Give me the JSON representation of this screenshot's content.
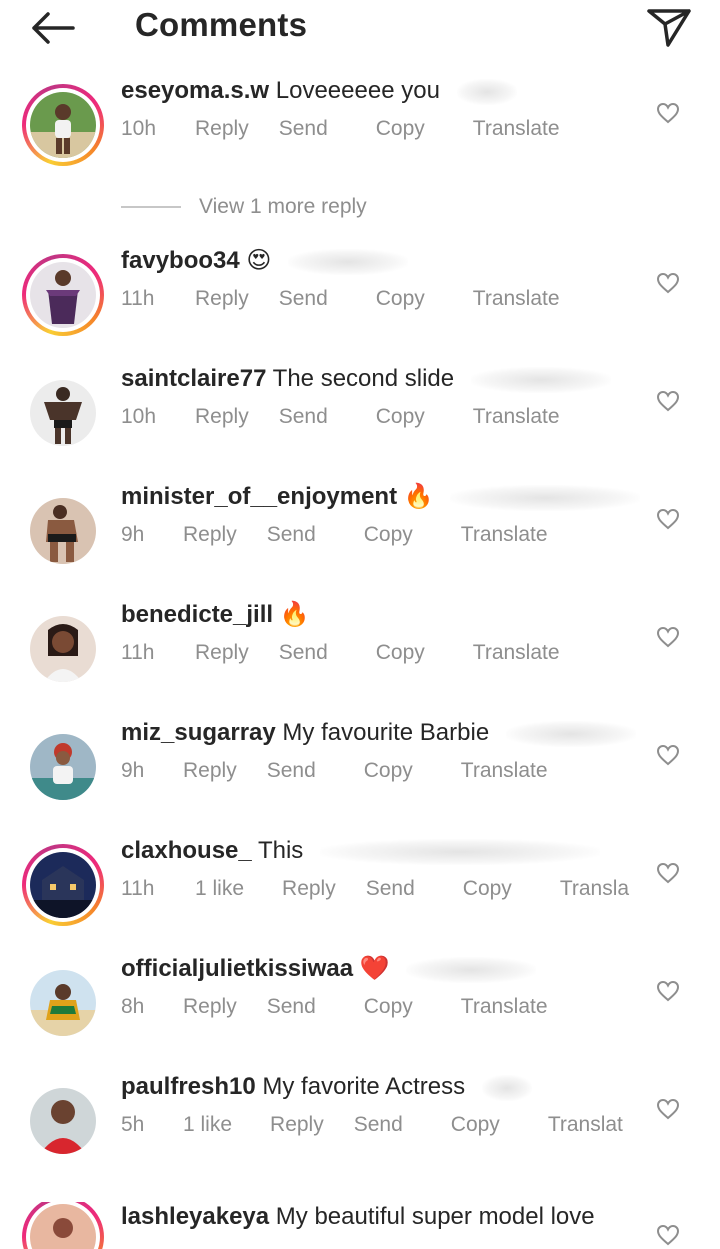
{
  "header": {
    "title": "Comments",
    "back_icon": "back-arrow-icon",
    "send_icon": "paper-plane-icon"
  },
  "actions": {
    "reply": "Reply",
    "send": "Send",
    "copy": "Copy",
    "translate": "Translate"
  },
  "view_more_replies": "View 1 more reply",
  "comments": [
    {
      "username": "eseyoma.s.w",
      "text": "Loveeeeee you",
      "time": "10h",
      "likes": "",
      "translate_label": "Translate",
      "story_ring": true
    },
    {
      "username": "favyboo34",
      "text": "😍",
      "time": "11h",
      "likes": "",
      "translate_label": "Translate",
      "story_ring": true
    },
    {
      "username": "saintclaire77",
      "text": "The second slide",
      "time": "10h",
      "likes": "",
      "translate_label": "Translate",
      "story_ring": false
    },
    {
      "username": "minister_of__enjoyment",
      "text": "🔥",
      "time": "9h",
      "likes": "",
      "translate_label": "Translate",
      "story_ring": false
    },
    {
      "username": "benedicte_jill",
      "text": "🔥",
      "time": "11h",
      "likes": "",
      "translate_label": "Translate",
      "story_ring": false
    },
    {
      "username": "miz_sugarray",
      "text": "My favourite Barbie",
      "time": "9h",
      "likes": "",
      "translate_label": "Translate",
      "story_ring": false
    },
    {
      "username": "claxhouse_",
      "text": "This",
      "time": "11h",
      "likes": "1 like",
      "translate_label": "Transla",
      "story_ring": true
    },
    {
      "username": "officialjulietkissiwaa",
      "text": "❤️",
      "time": "8h",
      "likes": "",
      "translate_label": "Translate",
      "story_ring": false
    },
    {
      "username": "paulfresh10",
      "text": "My favorite Actress",
      "time": "5h",
      "likes": "1 like",
      "translate_label": "Translat",
      "story_ring": false
    },
    {
      "username": "lashleyakeya",
      "text": "My beautiful super model love",
      "time": "",
      "likes": "",
      "translate_label": "",
      "story_ring": true
    }
  ],
  "colors": {
    "text_primary": "#262626",
    "text_secondary": "#8e8e8e",
    "story_ring": [
      "#f9ce34",
      "#ee2a7b",
      "#c13584"
    ]
  }
}
